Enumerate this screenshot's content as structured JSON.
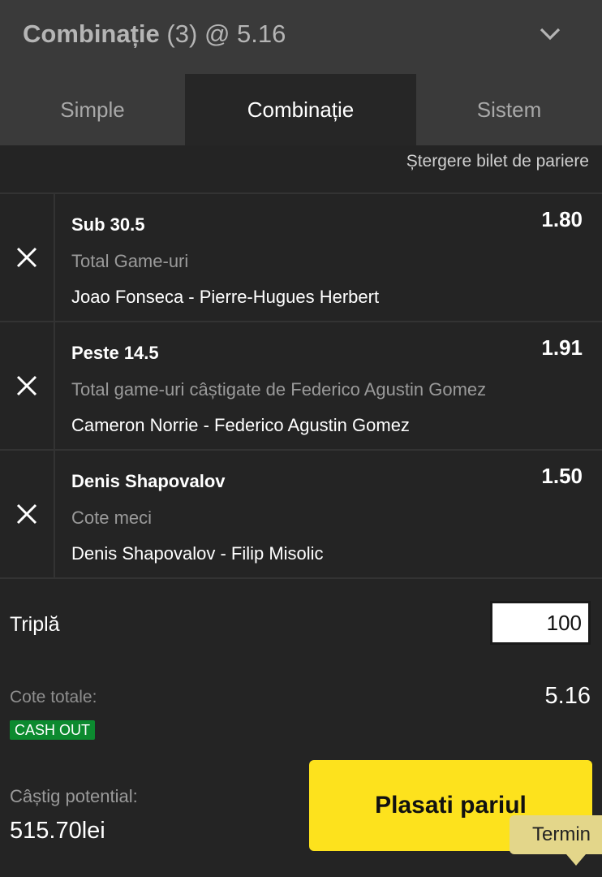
{
  "header": {
    "title": "Combinație",
    "count": "(3)",
    "odds": "@ 5.16"
  },
  "tabs": [
    {
      "label": "Simple",
      "active": false
    },
    {
      "label": "Combinație",
      "active": true
    },
    {
      "label": "Sistem",
      "active": false
    }
  ],
  "clear_label": "Ștergere bilet de pariere",
  "bets": [
    {
      "selection": "Sub 30.5",
      "market": "Total Game-uri",
      "event": "Joao Fonseca - Pierre-Hugues Herbert",
      "odds": "1.80"
    },
    {
      "selection": "Peste 14.5",
      "market": "Total game-uri câștigate de Federico Agustin Gomez",
      "event": "Cameron Norrie - Federico Agustin Gomez",
      "odds": "1.91"
    },
    {
      "selection": "Denis Shapovalov",
      "market": "Cote meci",
      "event": "Denis Shapovalov - Filip Misolic",
      "odds": "1.50"
    }
  ],
  "summary": {
    "stake_label": "Triplă",
    "stake_value": "100",
    "total_odds_label": "Cote totale:",
    "total_odds_value": "5.16",
    "cashout_badge": "CASH OUT",
    "potential_win_label": "Câștig potential:",
    "potential_win_value": "515.70lei",
    "place_bet_label": "Plasati pariul"
  },
  "tooltip": {
    "text": "Termin"
  },
  "colors": {
    "accent_yellow": "#fde21d",
    "cashout_green": "#0c8a2f",
    "panel_bg": "#242424",
    "header_bg": "#3a3a3a"
  }
}
